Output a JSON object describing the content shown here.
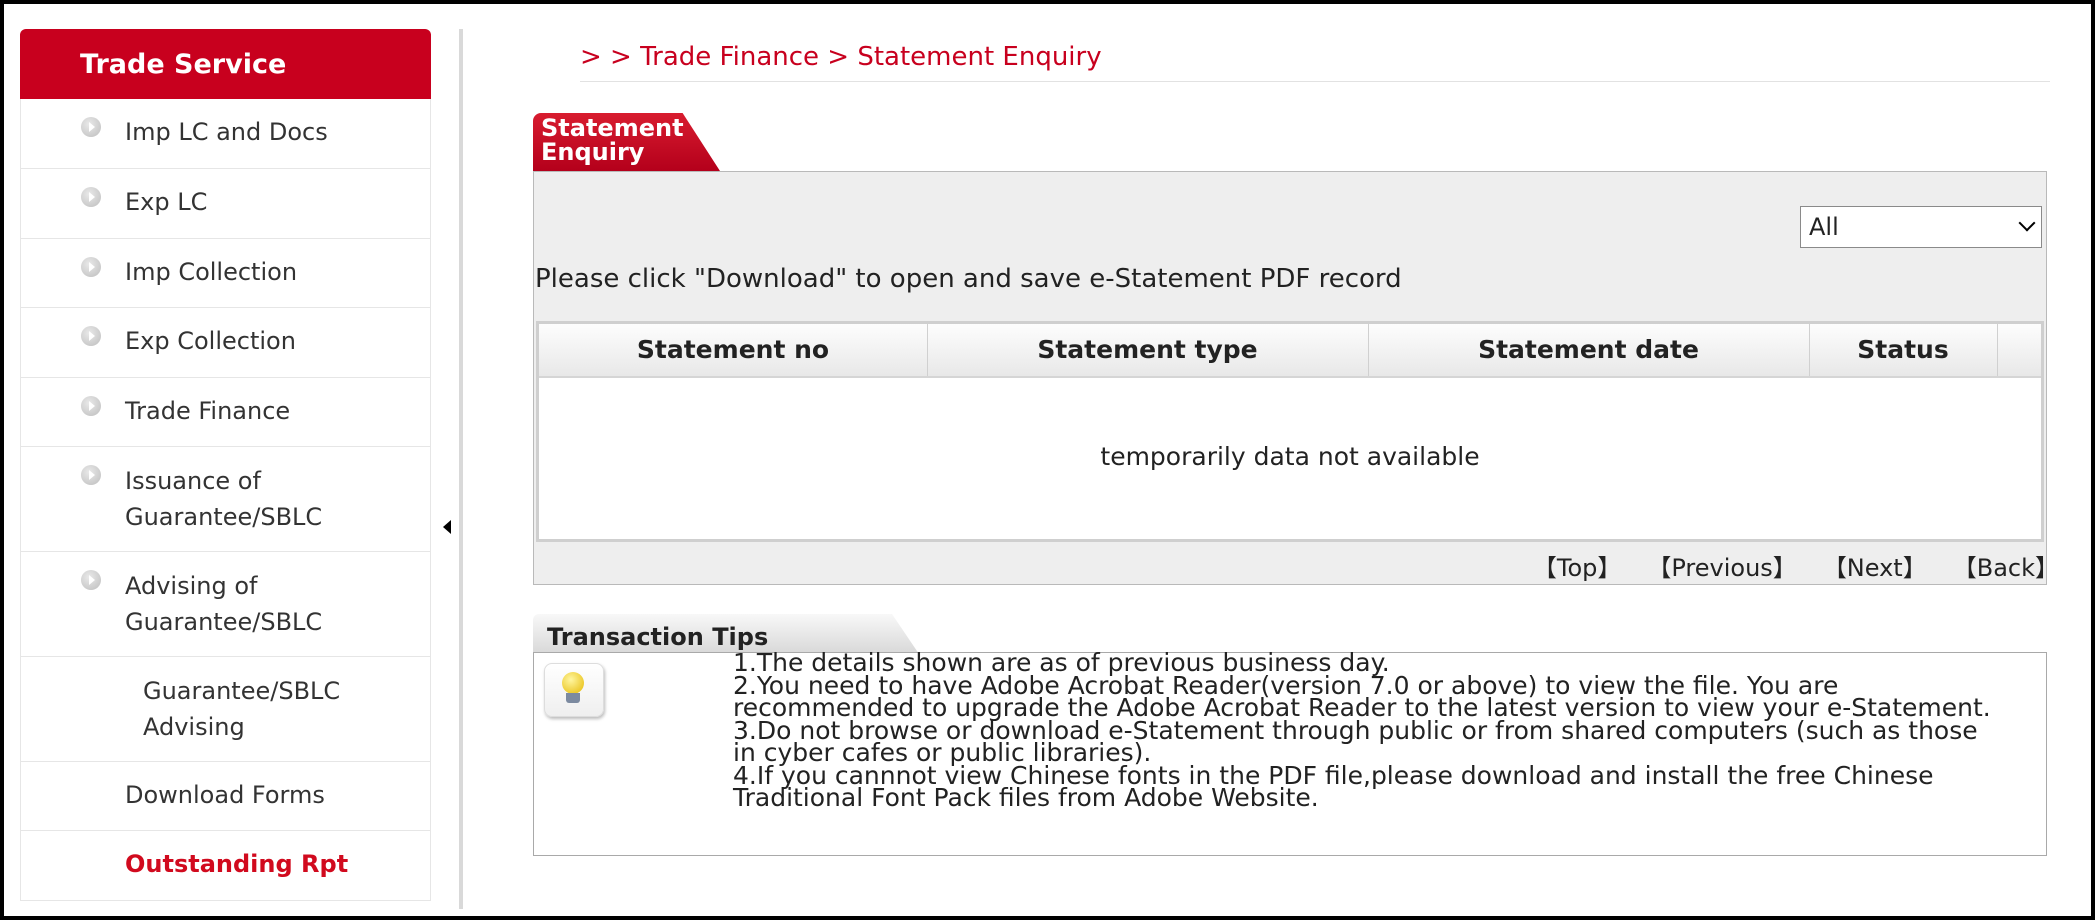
{
  "sidebar": {
    "title": "Trade Service",
    "items": [
      {
        "label": "Imp LC and Docs"
      },
      {
        "label": "Exp LC"
      },
      {
        "label": "Imp Collection"
      },
      {
        "label": "Exp Collection"
      },
      {
        "label": "Trade Finance"
      },
      {
        "label": "Issuance of\nGuarantee/SBLC"
      },
      {
        "label": "Advising of\nGuarantee/SBLC"
      },
      {
        "label": "Guarantee/SBLC\nAdvising"
      },
      {
        "label": "Download Forms"
      },
      {
        "label": "Outstanding Rpt"
      }
    ]
  },
  "breadcrumb": "> > Trade Finance > Statement Enquiry",
  "statement_panel": {
    "tab_label": "Statement\nEnquiry",
    "filter_selected": "All",
    "instruction": "Please click \"Download\" to open and save e-Statement PDF record",
    "columns": [
      "Statement no",
      "Statement type",
      "Statement date",
      "Status"
    ],
    "empty_message": "temporarily data not available",
    "pager": {
      "top": "【Top】",
      "previous": "【Previous】",
      "next": "【Next】",
      "back": "【Back】"
    }
  },
  "tips": {
    "title": "Transaction Tips",
    "lines": [
      "1.The details shown are as of previous business day.",
      "2.You need to have Adobe Acrobat Reader(version 7.0 or above) to view the file. You are\nrecommended to upgrade the Adobe Acrobat Reader to the latest version to view your e-Statement.",
      "3.Do not browse or download e-Statement through public or from shared computers (such as those\nin cyber cafes or public libraries).",
      "4.If you cannnot view Chinese fonts in the PDF file,please download and install the free Chinese\nTraditional Font Pack files from Adobe Website."
    ]
  },
  "colors": {
    "brand_red": "#c8001e",
    "active_link": "#d10a1e"
  }
}
